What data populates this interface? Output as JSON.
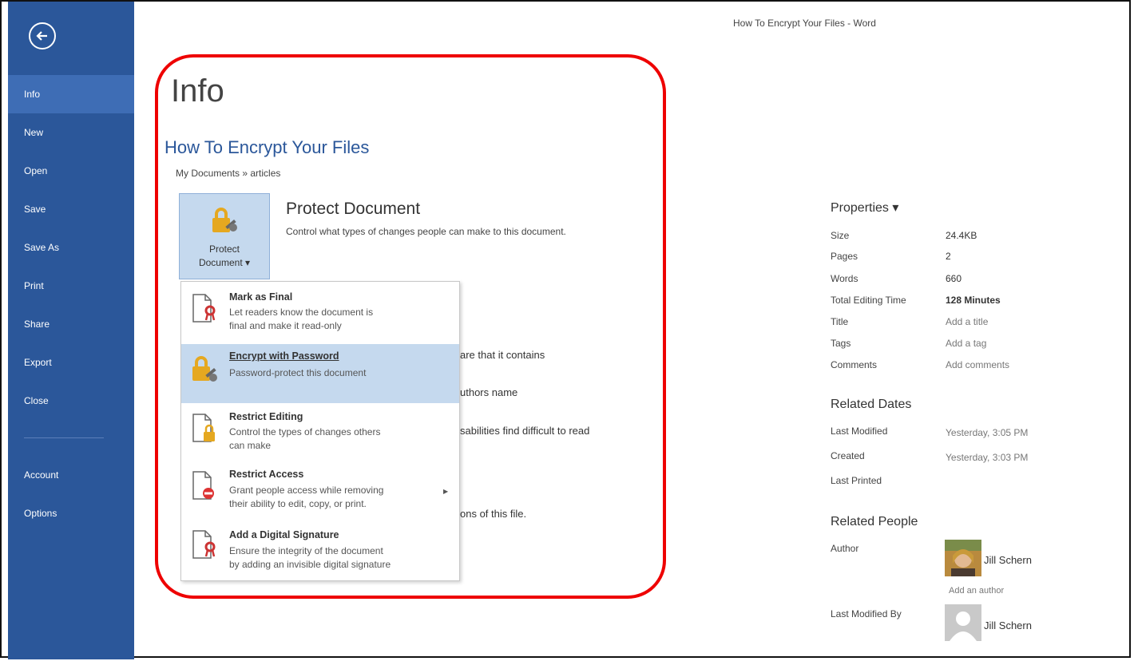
{
  "window": {
    "title": "How To Encrypt Your Files - Word"
  },
  "sidebar": {
    "items": [
      {
        "label": "Info",
        "active": true
      },
      {
        "label": "New"
      },
      {
        "label": "Open"
      },
      {
        "label": "Save"
      },
      {
        "label": "Save As"
      },
      {
        "label": "Print"
      },
      {
        "label": "Share"
      },
      {
        "label": "Export"
      },
      {
        "label": "Close"
      }
    ],
    "bottom": [
      {
        "label": "Account"
      },
      {
        "label": "Options"
      }
    ]
  },
  "main": {
    "heading": "Info",
    "doc_title": "How To Encrypt Your Files",
    "doc_path": "My Documents » articles",
    "protect": {
      "button_line1": "Protect",
      "button_line2": "Document ▾",
      "heading": "Protect Document",
      "description": "Control what types of changes people can make to this document."
    },
    "background_fragments": [
      "are that it contains",
      "uthors name",
      "sabilities find difficult to read",
      "ons of this file."
    ]
  },
  "dropdown": {
    "items": [
      {
        "title": "Mark as Final",
        "desc1": "Let readers know the document is",
        "desc2": "final and make it read-only"
      },
      {
        "title": "Encrypt with Password",
        "desc1": "Password-protect this document",
        "desc2": "",
        "highlight": true
      },
      {
        "title": "Restrict Editing",
        "desc1": "Control the types of changes others",
        "desc2": "can make"
      },
      {
        "title": "Restrict Access",
        "desc1": "Grant people access while removing",
        "desc2": "their ability to edit, copy, or print."
      },
      {
        "title": "Add a Digital Signature",
        "desc1": "Ensure the integrity of the document",
        "desc2": "by adding an invisible digital signature"
      }
    ]
  },
  "properties": {
    "title": "Properties ▾",
    "rows": [
      {
        "label": "Size",
        "value": "24.4KB"
      },
      {
        "label": "Pages",
        "value": "2"
      },
      {
        "label": "Words",
        "value": "660"
      },
      {
        "label": "Total Editing Time",
        "value": "128 Minutes"
      },
      {
        "label": "Title",
        "value": "Add a title"
      },
      {
        "label": "Tags",
        "value": "Add a tag"
      },
      {
        "label": "Comments",
        "value": "Add comments"
      }
    ]
  },
  "related_dates": {
    "title": "Related Dates",
    "rows": [
      {
        "label": "Last Modified",
        "value": "Yesterday, 3:05 PM"
      },
      {
        "label": "Created",
        "value": "Yesterday, 3:03 PM"
      },
      {
        "label": "Last Printed",
        "value": ""
      }
    ]
  },
  "related_people": {
    "title": "Related People",
    "author_label": "Author",
    "author_name": "Jill Schern",
    "add_author": "Add an author",
    "modified_label": "Last Modified By",
    "modified_name": "Jill Schern"
  },
  "colors": {
    "sidebar": "#2b579a",
    "highlight_outline": "#ee0000",
    "accent": "#2b579a"
  }
}
